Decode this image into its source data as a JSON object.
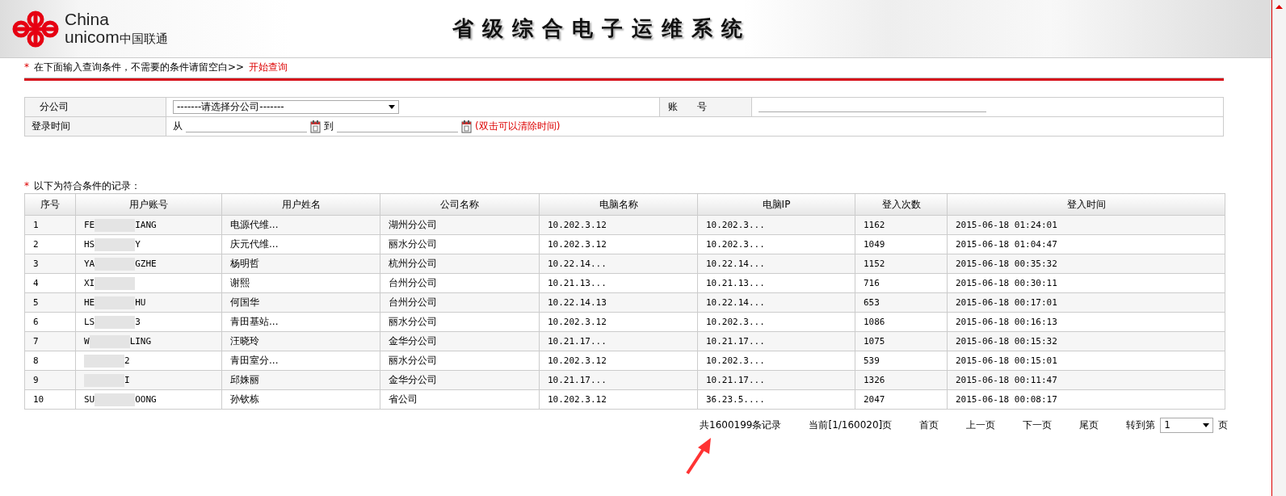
{
  "header": {
    "logo_line1": "China",
    "logo_line2": "unicom",
    "logo_cn": "中国联通",
    "title": "省级综合电子运维系统"
  },
  "query_hint": {
    "marker": "*",
    "text": "在下面输入查询条件，不需要的条件请留空白>>",
    "link": "开始查询"
  },
  "form": {
    "branch_label": "分公司",
    "branch_value": "-------请选择分公司-------",
    "account_label": "账　　号",
    "time_label": "登录时间",
    "from_label": "从",
    "to_label": "到",
    "clear_hint": "(双击可以清除时间)"
  },
  "records": {
    "marker": "*",
    "label": "以下为符合条件的记录："
  },
  "table": {
    "columns": [
      "序号",
      "用户账号",
      "用户姓名",
      "公司名称",
      "电脑名称",
      "电脑IP",
      "登入次数",
      "登入时间"
    ],
    "rows": [
      {
        "no": "1",
        "account_start": "FE",
        "account_end": "IANG",
        "name": "电源代维...",
        "company": "湖州分公司",
        "pc": "10.202.3.12",
        "ip": "10.202.3...",
        "count": "1162",
        "time": "2015-06-18 01:24:01"
      },
      {
        "no": "2",
        "account_start": "HS",
        "account_end": "Y",
        "name": "庆元代维...",
        "company": "丽水分公司",
        "pc": "10.202.3.12",
        "ip": "10.202.3...",
        "count": "1049",
        "time": "2015-06-18 01:04:47"
      },
      {
        "no": "3",
        "account_start": "YA",
        "account_end": "GZHE",
        "name": "杨明哲",
        "company": "杭州分公司",
        "pc": "10.22.14...",
        "ip": "10.22.14...",
        "count": "1152",
        "time": "2015-06-18 00:35:32"
      },
      {
        "no": "4",
        "account_start": "XI",
        "name": "谢熙",
        "company": "台州分公司",
        "pc": "10.21.13...",
        "ip": "10.21.13...",
        "count": "716",
        "time": "2015-06-18 00:30:11"
      },
      {
        "no": "5",
        "account_start": "HE",
        "account_end": "HU",
        "name": "何国华",
        "company": "台州分公司",
        "pc": "10.22.14.13",
        "ip": "10.22.14...",
        "count": "653",
        "time": "2015-06-18 00:17:01"
      },
      {
        "no": "6",
        "account_start": "LS",
        "account_end": "3",
        "name": "青田基站...",
        "company": "丽水分公司",
        "pc": "10.202.3.12",
        "ip": "10.202.3...",
        "count": "1086",
        "time": "2015-06-18 00:16:13"
      },
      {
        "no": "7",
        "account_start": "W",
        "account_end": "LING",
        "name": "汪晓玲",
        "company": "金华分公司",
        "pc": "10.21.17...",
        "ip": "10.21.17...",
        "count": "1075",
        "time": "2015-06-18 00:15:32"
      },
      {
        "no": "8",
        "account_end": "2",
        "name": "青田室分...",
        "company": "丽水分公司",
        "pc": "10.202.3.12",
        "ip": "10.202.3...",
        "count": "539",
        "time": "2015-06-18 00:15:01"
      },
      {
        "no": "9",
        "account_end": "I",
        "name": "邱姝丽",
        "company": "金华分公司",
        "pc": "10.21.17...",
        "ip": "10.21.17...",
        "count": "1326",
        "time": "2015-06-18 00:11:47"
      },
      {
        "no": "10",
        "account_start": "SU",
        "account_end": "OONG",
        "name": "孙钦栋",
        "company": "省公司",
        "pc": "10.202.3.12",
        "ip": "36.23.5....",
        "count": "2047",
        "time": "2015-06-18 00:08:17"
      }
    ]
  },
  "pagination": {
    "total": "共1600199条记录",
    "current": "当前[1/160020]页",
    "first": "首页",
    "prev": "上一页",
    "next": "下一页",
    "last": "尾页",
    "goto_label": "转到第",
    "page_value": "1",
    "page_suffix": "页"
  }
}
